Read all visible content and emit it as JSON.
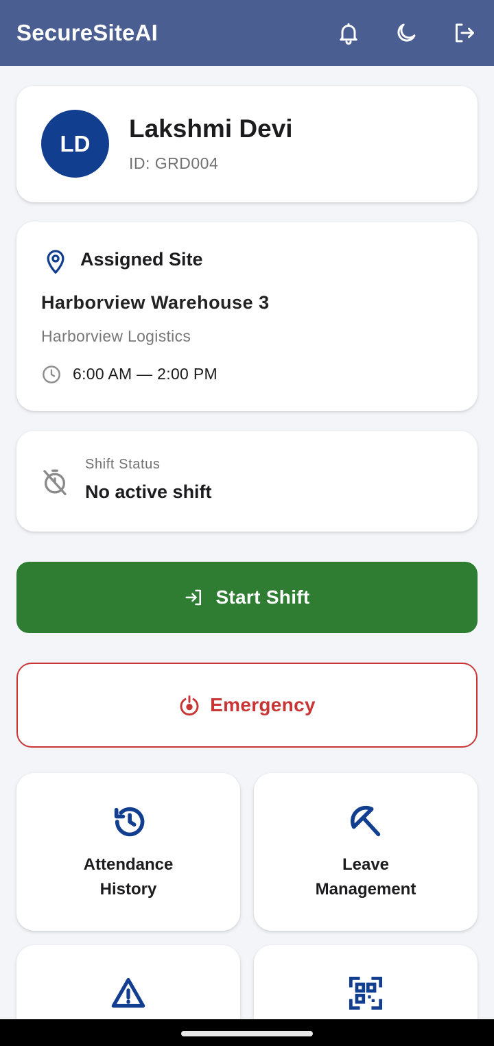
{
  "appbar": {
    "title": "SecureSiteAI",
    "icons": [
      "bell-icon",
      "moon-icon",
      "logout-icon"
    ],
    "background": "#4a5e92"
  },
  "profile": {
    "initials": "LD",
    "name": "Lakshmi Devi",
    "id_text": "ID: GRD004",
    "avatar_color": "#123e8f"
  },
  "site": {
    "heading": "Assigned Site",
    "name": "Harborview Warehouse 3",
    "company": "Harborview Logistics",
    "hours": "6:00 AM — 2:00 PM"
  },
  "shift_status": {
    "label": "Shift Status",
    "value": "No active shift"
  },
  "actions": {
    "start_shift_label": "Start Shift",
    "start_shift_color": "#2e7d32",
    "emergency_label": "Emergency",
    "emergency_color": "#c73535"
  },
  "tiles": [
    {
      "label_line1": "Attendance",
      "label_line2": "History",
      "icon": "history-icon"
    },
    {
      "label_line1": "Leave",
      "label_line2": "Management",
      "icon": "umbrella-off-icon"
    },
    {
      "icon": "warning-icon"
    },
    {
      "icon": "qr-scan-icon"
    }
  ],
  "accent_color": "#123e8f"
}
